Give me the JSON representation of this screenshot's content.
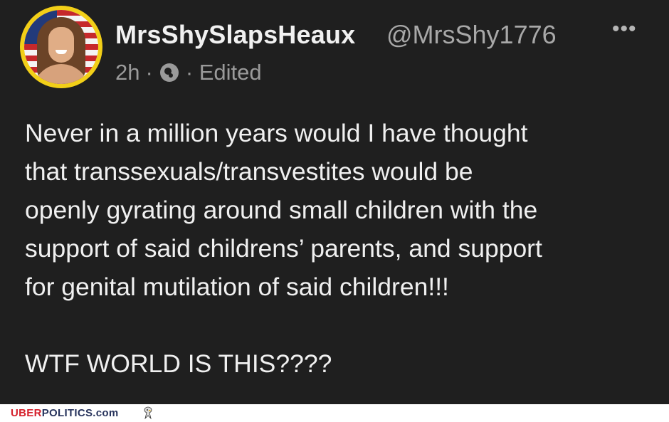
{
  "post": {
    "display_name": "MrsShySlapsHeaux",
    "handle": "@MrsShy1776",
    "time": "2h",
    "edited": "· Edited",
    "separator": "·",
    "icons": {
      "avatar": "avatar-photo",
      "globe": "globe-icon",
      "more": "more-options-icon"
    },
    "more_label": "•••",
    "paragraphs": [
      "Never in a million years would I have thought\nthat transsexuals/transvestites would be\nopenly gyrating around small children with the\nsupport of said childrens’ parents, and support\nfor genital mutilation of said children!!!",
      "WTF WORLD IS THIS????"
    ]
  },
  "footer": {
    "brand_part1": "UBER",
    "brand_part2": "POLITICS.com",
    "brand_colors": {
      "uber": "#d5202b",
      "politics": "#27335c"
    },
    "logo_icon": "eagle-icon"
  }
}
